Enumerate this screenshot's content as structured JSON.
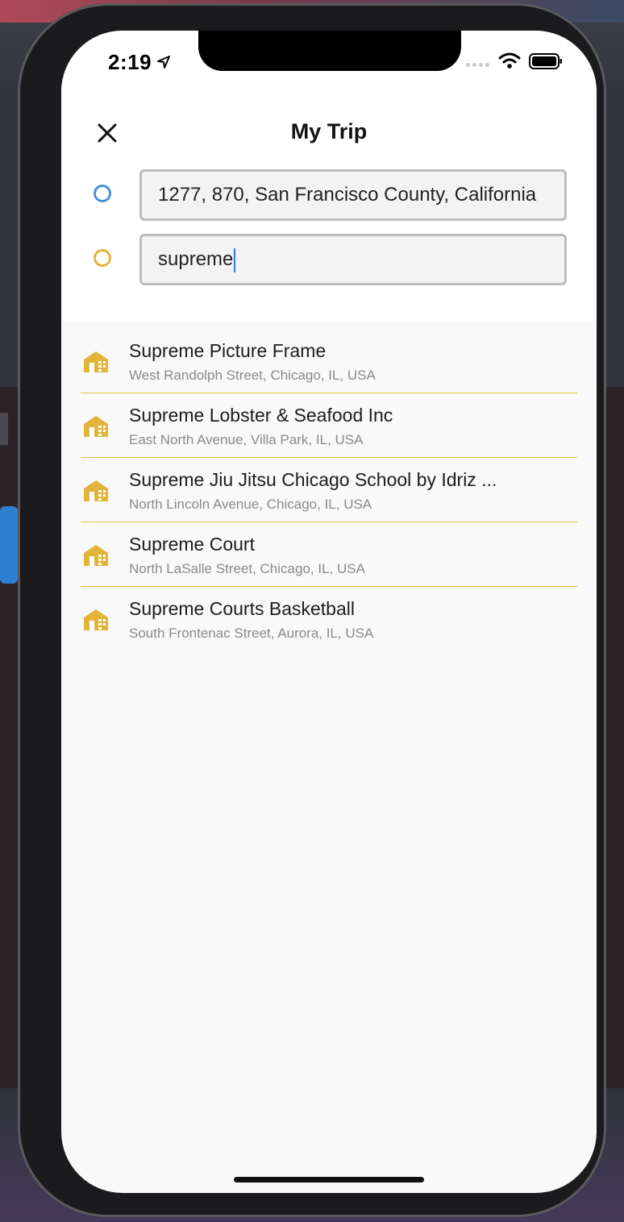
{
  "status_bar": {
    "time": "2:19",
    "location_icon": "location-arrow-icon",
    "wifi_icon": "wifi-icon",
    "battery_icon": "battery-icon"
  },
  "header": {
    "title": "My Trip",
    "close_icon": "close-icon"
  },
  "route": {
    "origin_value": "1277, 870, San Francisco County, California",
    "destination_value": "supreme",
    "origin_color": "#4a90d9",
    "destination_color": "#e3b43a"
  },
  "results": [
    {
      "name": "Supreme Picture Frame",
      "address": "West Randolph Street, Chicago, IL, USA",
      "icon": "building-icon"
    },
    {
      "name": "Supreme Lobster & Seafood Inc",
      "address": "East North Avenue, Villa Park, IL, USA",
      "icon": "building-icon"
    },
    {
      "name": "Supreme Jiu Jitsu Chicago School by Idriz ...",
      "address": "North Lincoln Avenue, Chicago, IL, USA",
      "icon": "building-icon"
    },
    {
      "name": "Supreme Court",
      "address": "North LaSalle Street, Chicago, IL, USA",
      "icon": "building-icon"
    },
    {
      "name": "Supreme Courts Basketball",
      "address": "South Frontenac Street, Aurora, IL, USA",
      "icon": "building-icon"
    }
  ],
  "colors": {
    "accent_yellow": "#e3b43a",
    "accent_blue": "#4a90d9",
    "divider": "#e6c24a"
  }
}
